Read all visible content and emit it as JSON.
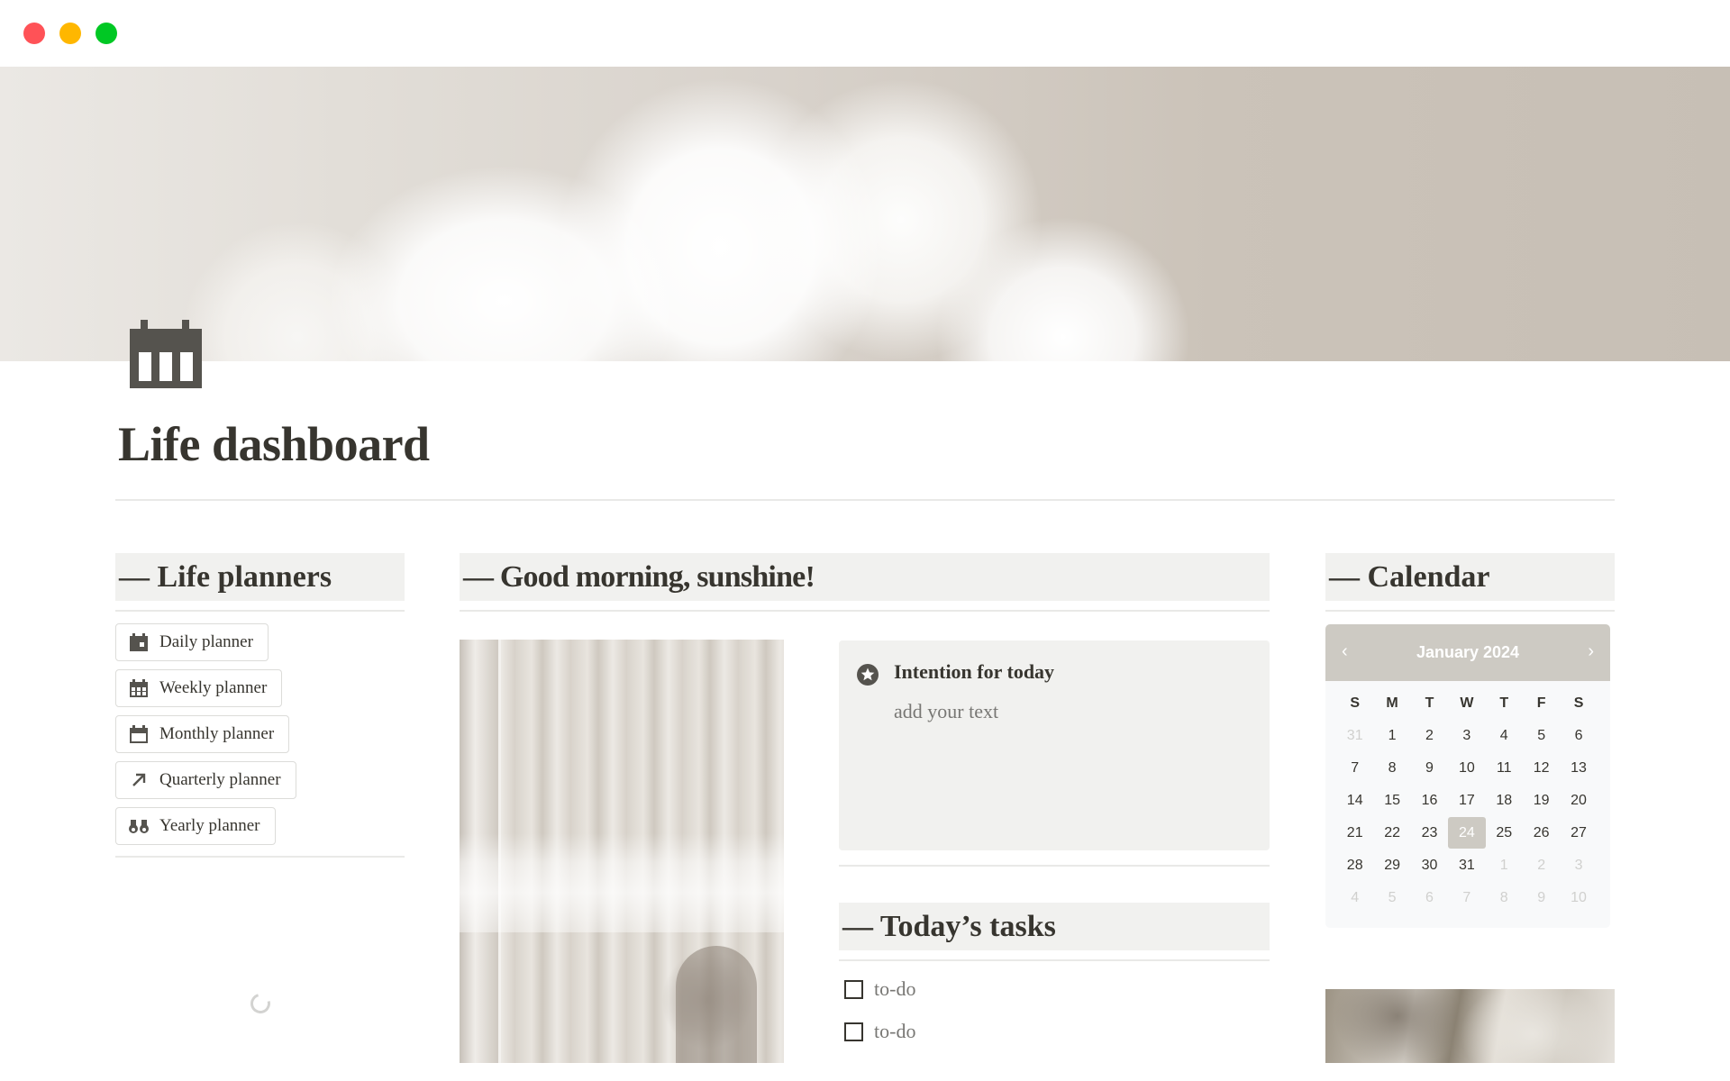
{
  "window": {
    "controls": [
      "close",
      "minimize",
      "maximize"
    ]
  },
  "page": {
    "icon": "calendar-icon",
    "title": "Life dashboard"
  },
  "life_planners": {
    "heading": "— Life planners",
    "items": [
      {
        "label": "Daily planner",
        "icon": "calendar-day-icon"
      },
      {
        "label": "Weekly planner",
        "icon": "calendar-week-icon"
      },
      {
        "label": "Monthly planner",
        "icon": "calendar-month-icon"
      },
      {
        "label": "Quarterly planner",
        "icon": "arrow-up-right-icon"
      },
      {
        "label": "Yearly planner",
        "icon": "binoculars-icon"
      }
    ]
  },
  "greeting": {
    "heading": "— Good morning, sunshine!"
  },
  "intention": {
    "icon": "star-circle-icon",
    "title": "Intention for today",
    "placeholder": "add your text"
  },
  "tasks": {
    "heading": "— Today’s tasks",
    "items": [
      {
        "label": "to-do",
        "checked": false
      },
      {
        "label": "to-do",
        "checked": false
      }
    ]
  },
  "calendar": {
    "heading": "— Calendar",
    "month_label": "January 2024",
    "prev": "‹",
    "next": "›",
    "weekdays": [
      "S",
      "M",
      "T",
      "W",
      "T",
      "F",
      "S"
    ],
    "today": 24,
    "weeks": [
      [
        {
          "d": "31",
          "m": true
        },
        {
          "d": "1"
        },
        {
          "d": "2"
        },
        {
          "d": "3"
        },
        {
          "d": "4"
        },
        {
          "d": "5"
        },
        {
          "d": "6"
        }
      ],
      [
        {
          "d": "7"
        },
        {
          "d": "8"
        },
        {
          "d": "9"
        },
        {
          "d": "10"
        },
        {
          "d": "11"
        },
        {
          "d": "12"
        },
        {
          "d": "13"
        }
      ],
      [
        {
          "d": "14"
        },
        {
          "d": "15"
        },
        {
          "d": "16"
        },
        {
          "d": "17"
        },
        {
          "d": "18"
        },
        {
          "d": "19"
        },
        {
          "d": "20"
        }
      ],
      [
        {
          "d": "21"
        },
        {
          "d": "22"
        },
        {
          "d": "23"
        },
        {
          "d": "24",
          "t": true
        },
        {
          "d": "25"
        },
        {
          "d": "26"
        },
        {
          "d": "27"
        }
      ],
      [
        {
          "d": "28"
        },
        {
          "d": "29"
        },
        {
          "d": "30"
        },
        {
          "d": "31"
        },
        {
          "d": "1",
          "m": true
        },
        {
          "d": "2",
          "m": true
        },
        {
          "d": "3",
          "m": true
        }
      ],
      [
        {
          "d": "4",
          "m": true
        },
        {
          "d": "5",
          "m": true
        },
        {
          "d": "6",
          "m": true
        },
        {
          "d": "7",
          "m": true
        },
        {
          "d": "8",
          "m": true
        },
        {
          "d": "9",
          "m": true
        },
        {
          "d": "10",
          "m": true
        }
      ]
    ]
  },
  "colors": {
    "text": "#37352f",
    "muted_text": "#787774",
    "section_bg": "#f1f1ef",
    "calendar_accent": "#cdcac3"
  }
}
